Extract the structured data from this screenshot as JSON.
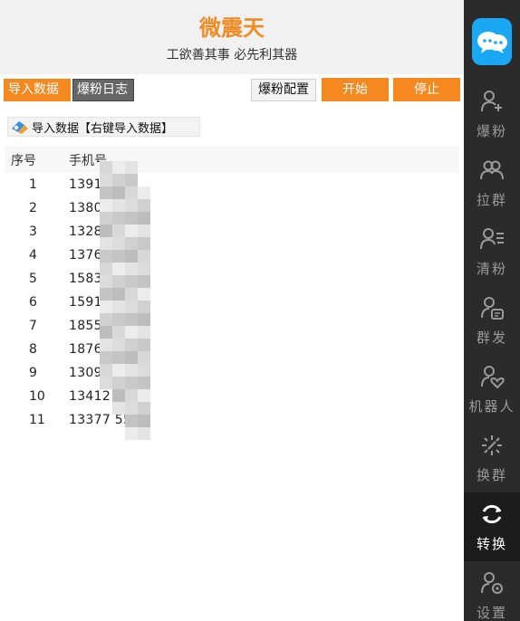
{
  "header": {
    "title": "微震天",
    "slogan": "工欲善其事 必先利其器"
  },
  "toolbar": {
    "tab_import": "导入数据",
    "tab_log": "爆粉日志",
    "config_label": "爆粉配置",
    "start_label": "开始",
    "stop_label": "停止"
  },
  "import": {
    "label": "导入数据【右键导入数据】"
  },
  "table": {
    "headers": {
      "index": "序号",
      "phone": "手机号"
    },
    "rows": [
      {
        "index": "1",
        "phone": "1391     111"
      },
      {
        "index": "2",
        "phone": "1380      000"
      },
      {
        "index": "3",
        "phone": "1328      999"
      },
      {
        "index": "4",
        "phone": "1376      888"
      },
      {
        "index": "5",
        "phone": "1583      999"
      },
      {
        "index": "6",
        "phone": "1591      777"
      },
      {
        "index": "7",
        "phone": "1855      566"
      },
      {
        "index": "8",
        "phone": "1876      222"
      },
      {
        "index": "9",
        "phone": "1309      222"
      },
      {
        "index": "10",
        "phone": "13412     55"
      },
      {
        "index": "11",
        "phone": "13377     55"
      }
    ]
  },
  "sidebar": {
    "items": [
      {
        "label": "爆粉",
        "icon": "user-add-icon"
      },
      {
        "label": "拉群",
        "icon": "group-icon"
      },
      {
        "label": "清粉",
        "icon": "user-list-icon"
      },
      {
        "label": "群发",
        "icon": "user-message-icon"
      },
      {
        "label": "机器人",
        "icon": "user-heart-icon"
      },
      {
        "label": "换群",
        "icon": "sparkle-icon"
      },
      {
        "label": "转换",
        "icon": "refresh-icon"
      },
      {
        "label": "设置",
        "icon": "user-settings-icon"
      }
    ],
    "active": "转换"
  },
  "colors": {
    "accent": "#f5891f",
    "title": "#f08a24",
    "sidebar_bg": "#2b2b2b",
    "logo_bg": "#1aa8f5"
  }
}
